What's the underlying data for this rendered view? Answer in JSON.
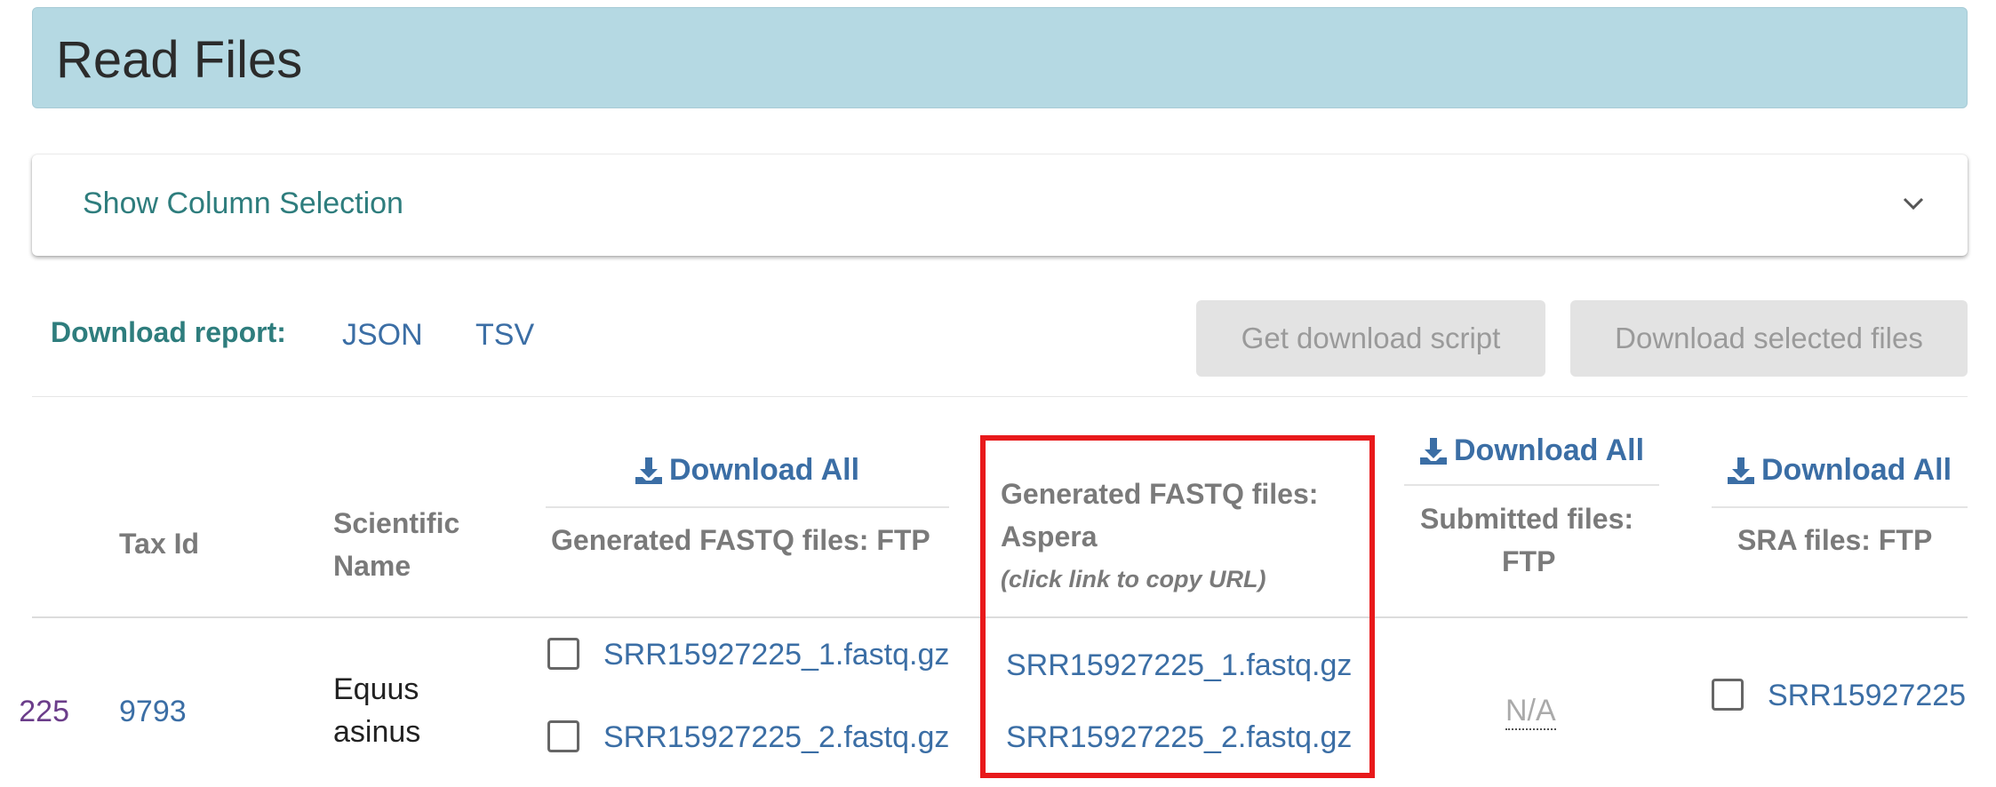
{
  "header": {
    "title": "Read Files"
  },
  "column_selection": {
    "label": "Show Column Selection",
    "icon": "chevron-down-icon"
  },
  "download_report": {
    "label": "Download report:",
    "json": "JSON",
    "tsv": "TSV"
  },
  "buttons": {
    "get_script": "Get download script",
    "download_selected": "Download selected files"
  },
  "table": {
    "headers": {
      "tax_id": "Tax Id",
      "scientific_name_line1": "Scientific",
      "scientific_name_line2": "Name",
      "fastq_ftp": "Generated FASTQ files: FTP",
      "fastq_aspera_line1": "Generated FASTQ files:",
      "fastq_aspera_line2": "Aspera",
      "fastq_aspera_note": "(click link to copy URL)",
      "submitted_line1": "Submitted files:",
      "submitted_line2": "FTP",
      "sra_ftp": "SRA files: FTP"
    },
    "download_all": "Download All",
    "row": {
      "accession_fragment": "225",
      "tax_id": "9793",
      "scientific_name_line1": "Equus",
      "scientific_name_line2": "asinus",
      "fastq_ftp": [
        "SRR15927225_1.fastq.gz",
        "SRR15927225_2.fastq.gz"
      ],
      "fastq_aspera": [
        "SRR15927225_1.fastq.gz",
        "SRR15927225_2.fastq.gz"
      ],
      "submitted": "N/A",
      "sra_ftp": "SRR15927225"
    }
  },
  "colors": {
    "accent_teal": "#2e7d7d",
    "link_blue": "#3b6ea5",
    "highlight_red": "#e8191b",
    "header_bg": "#b5d9e3"
  }
}
